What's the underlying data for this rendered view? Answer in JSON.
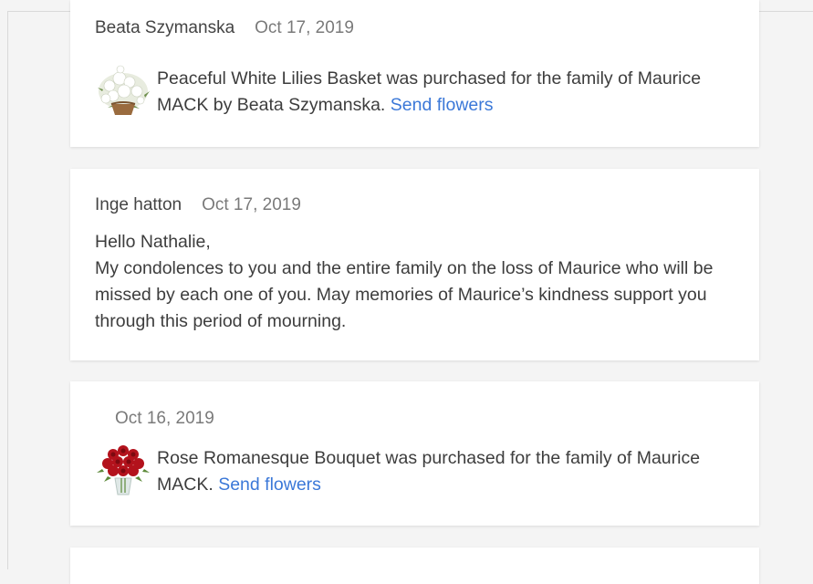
{
  "entries": [
    {
      "author": "Beata Szymanska",
      "date": "Oct 17, 2019",
      "text": "Peaceful White Lilies Basket was purchased for the family of Maurice MACK by Beata Szymanska.",
      "link": "Send flowers",
      "thumbnail": "white-lilies-basket"
    },
    {
      "author": "Inge hatton",
      "date": "Oct 17, 2019",
      "greeting": "Hello Nathalie,",
      "message": "My condolences to you and the entire family on the loss of Maurice who will be missed by each one of you. May memories of Maurice’s kindness support you through this period of mourning."
    },
    {
      "date": "Oct 16, 2019",
      "text": "Rose Romanesque Bouquet was purchased for the family of Maurice MACK.",
      "link": "Send flowers",
      "thumbnail": "red-rose-bouquet"
    }
  ],
  "colors": {
    "link": "#3b78d8",
    "page_bg": "#f4f4f4",
    "card_bg": "#ffffff"
  }
}
